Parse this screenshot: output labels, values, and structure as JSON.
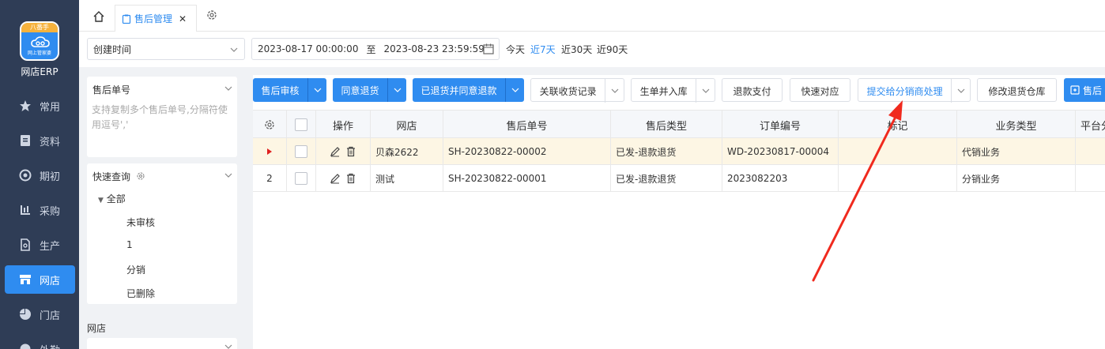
{
  "nav": {
    "logo_top": "八番手",
    "logo_sub": "网上管家婆",
    "brand": "网店ERP",
    "items": [
      {
        "label": "常用",
        "icon": "star-icon"
      },
      {
        "label": "资料",
        "icon": "document-icon"
      },
      {
        "label": "期初",
        "icon": "target-icon"
      },
      {
        "label": "采购",
        "icon": "chart-icon"
      },
      {
        "label": "生产",
        "icon": "file-icon"
      },
      {
        "label": "网店",
        "icon": "store-icon",
        "active": true
      },
      {
        "label": "门店",
        "icon": "pie-icon"
      },
      {
        "label": "外勤",
        "icon": "field-icon"
      }
    ]
  },
  "tabs": {
    "active_label": "售后管理"
  },
  "filter": {
    "date_type": "创建时间",
    "start": "2023-08-17 00:00:00",
    "to": "至",
    "end": "2023-08-23 23:59:59",
    "quick": [
      "今天",
      "近7天",
      "近30天",
      "近90天"
    ]
  },
  "left": {
    "order_no_title": "售后单号",
    "order_no_placeholder": "支持复制多个售后单号,分隔符使用逗号','",
    "quick_query_title": "快速查询",
    "tree_root": "全部",
    "tree_items": [
      "未审核",
      "1",
      "分销",
      "已删除"
    ],
    "store_label": "网店"
  },
  "toolbar": {
    "audit": "售后审核",
    "agree_return": "同意退货",
    "returned_refund": "已退货并同意退款",
    "link_receipt": "关联收货记录",
    "gen_stock": "生单并入库",
    "refund_pay": "退款支付",
    "quick_match": "快速对应",
    "submit_distributor": "提交给分销商处理",
    "modify_warehouse": "修改退货仓库",
    "aftersale": "售后"
  },
  "table": {
    "headers": [
      "操作",
      "网店",
      "售后单号",
      "售后类型",
      "订单编号",
      "标记",
      "业务类型",
      "平台分"
    ],
    "rows": [
      {
        "idx": "",
        "store": "贝森2622",
        "no": "SH-20230822-00002",
        "type": "已发-退款退货",
        "order": "WD-20230817-00004",
        "mark": "",
        "biz": "代销业务"
      },
      {
        "idx": "2",
        "store": "测试",
        "no": "SH-20230822-00001",
        "type": "已发-退款退货",
        "order": "2023082203",
        "mark": "",
        "biz": "分销业务"
      }
    ]
  },
  "colors": {
    "primary": "#2f8cf0",
    "nav_bg": "#2f3d56",
    "annotation": "#f02a1e",
    "row_highlight": "#fdf6e4"
  }
}
